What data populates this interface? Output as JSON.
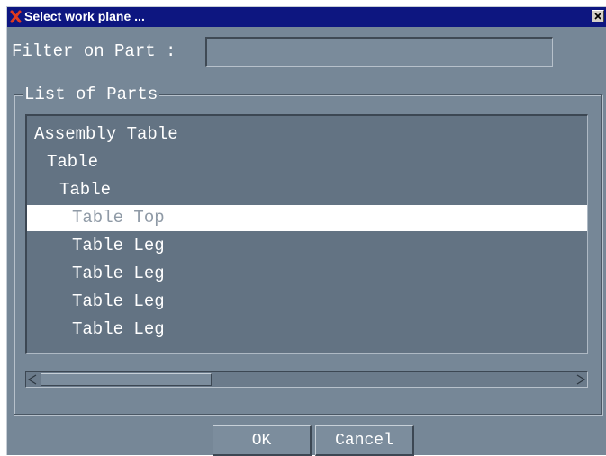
{
  "window": {
    "title": "Select work plane ...",
    "close_icon": "close-icon",
    "app_icon": "red-x-icon"
  },
  "filter": {
    "label": "Filter on Part :",
    "value": ""
  },
  "parts_group": {
    "label": "List of Parts",
    "items": [
      {
        "label": "Assembly Table",
        "depth": 0,
        "selected": false
      },
      {
        "label": "Table",
        "depth": 1,
        "selected": false
      },
      {
        "label": "Table",
        "depth": 2,
        "selected": false
      },
      {
        "label": "Table Top",
        "depth": 3,
        "selected": true
      },
      {
        "label": "Table Leg",
        "depth": 3,
        "selected": false
      },
      {
        "label": "Table Leg",
        "depth": 3,
        "selected": false
      },
      {
        "label": "Table Leg",
        "depth": 3,
        "selected": false
      },
      {
        "label": "Table Leg",
        "depth": 3,
        "selected": false
      }
    ]
  },
  "buttons": {
    "ok": "OK",
    "cancel": "Cancel"
  },
  "colors": {
    "titlebar": "#0d1680",
    "dialog_bg": "#768797",
    "list_bg": "#637383",
    "selection_bg": "#ffffff"
  }
}
